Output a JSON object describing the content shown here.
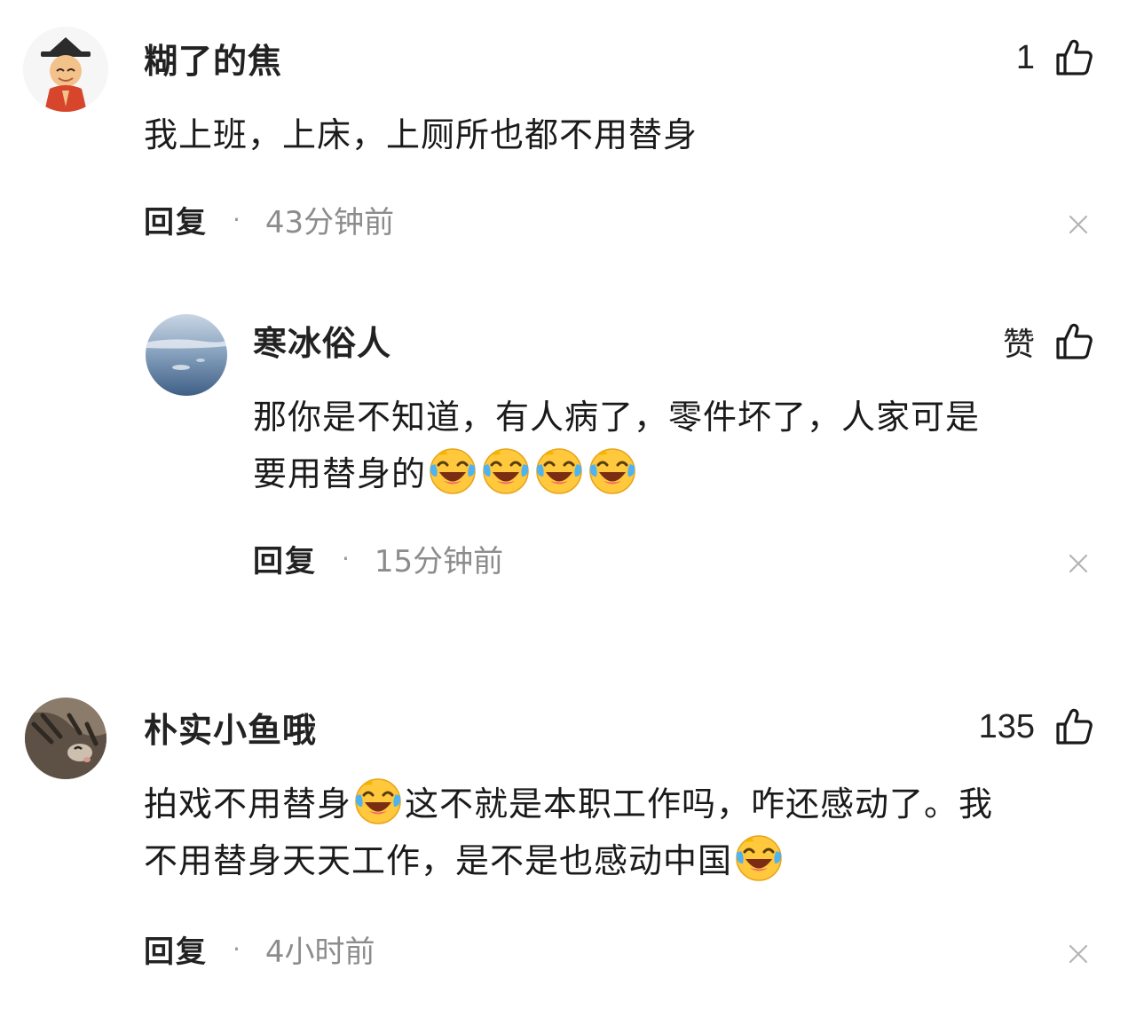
{
  "comments": [
    {
      "username": "糊了的焦",
      "likes": "1",
      "text": "我上班，上床，上厕所也都不用替身",
      "reply_label": "回复",
      "separator": "·",
      "time": "43分钟前",
      "avatar_icon": "cartoon-scholar-avatar"
    },
    {
      "username": "寒冰俗人",
      "likes": "赞",
      "text_line1": "那你是不知道，有人病了，零件坏了，人家可是",
      "text_line2": "要用替身的",
      "emoji_icon": "laughing-tears-emoji",
      "reply_label": "回复",
      "separator": "·",
      "time": "15分钟前",
      "avatar_icon": "aerial-sky-avatar"
    },
    {
      "username": "朴实小鱼哦",
      "likes": "135",
      "text_line1_a": "拍戏不用替身",
      "text_line1_b": "这不就是本职工作吗，咋还感动了。我",
      "text_line2": "不用替身天天工作，是不是也感动中国",
      "emoji_icon": "laughing-tears-emoji",
      "reply_label": "回复",
      "separator": "·",
      "time": "4小时前",
      "avatar_icon": "cat-photo-avatar"
    }
  ],
  "icons": {
    "like": "thumbs-up-icon",
    "close": "close-icon"
  },
  "colors": {
    "text": "#1a1a1a",
    "meta": "#8c8c8c",
    "background": "#ffffff"
  }
}
